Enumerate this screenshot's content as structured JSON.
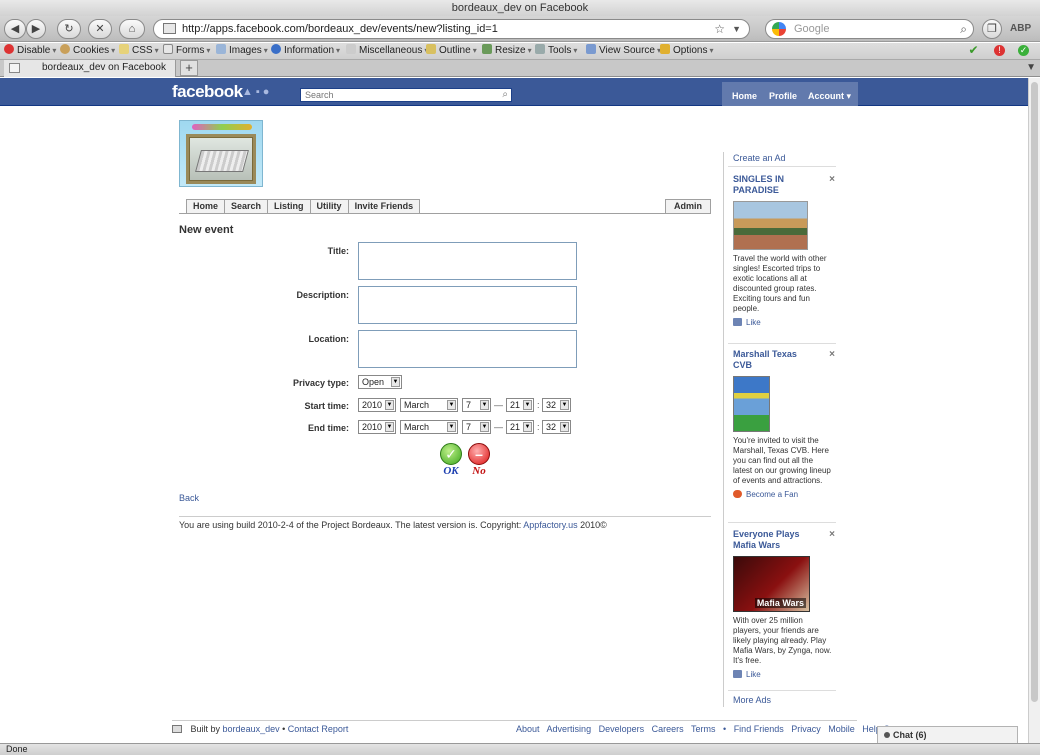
{
  "browser": {
    "window_title": "bordeaux_dev on Facebook",
    "url": "http://apps.facebook.com/bordeaux_dev/events/new?listing_id=1",
    "search_placeholder": "Google",
    "abp": "ABP",
    "tab_title": "bordeaux_dev on Facebook",
    "status": "Done",
    "dev_toolbar": [
      "Disable",
      "Cookies",
      "CSS",
      "Forms",
      "Images",
      "Information",
      "Miscellaneous",
      "Outline",
      "Resize",
      "Tools",
      "View Source",
      "Options"
    ]
  },
  "fb": {
    "logo": "facebook",
    "search_placeholder": "Search",
    "nav": {
      "home": "Home",
      "profile": "Profile",
      "account": "Account ▾"
    }
  },
  "app": {
    "tabs": [
      "Home",
      "Search",
      "Listing",
      "Utility",
      "Invite Friends"
    ],
    "admin_tab": "Admin",
    "heading": "New event",
    "form": {
      "title_label": "Title:",
      "description_label": "Description:",
      "location_label": "Location:",
      "privacy_label": "Privacy type:",
      "privacy_value": "Open",
      "start_label": "Start time:",
      "end_label": "End time:",
      "start": {
        "year": "2010",
        "month": "March",
        "day": "7",
        "hour": "21",
        "minute": "32"
      },
      "end": {
        "year": "2010",
        "month": "March",
        "day": "7",
        "hour": "21",
        "minute": "32"
      },
      "dash": "—",
      "colon": ":"
    },
    "ok_label": "OK",
    "no_label": "No",
    "back": "Back",
    "build_text": "You are using build 2010-2-4 of the Project Bordeaux. The latest version is. Copyright:",
    "build_link": "Appfactory.us",
    "build_year": "2010©"
  },
  "ads": {
    "create": "Create an Ad",
    "items": [
      {
        "title": "SINGLES IN PARADISE",
        "body": "Travel the world with other singles! Escorted trips to exotic locations all at discounted group rates. Exciting tours and fun people.",
        "action": "Like"
      },
      {
        "title": "Marshall Texas CVB",
        "body": "You're invited to visit the Marshall, Texas CVB. Here you can find out all the latest on our growing lineup of events and attractions.",
        "action": "Become a Fan"
      },
      {
        "title": "Everyone Plays Mafia Wars",
        "body": "With over 25 million players, your friends are likely playing already. Play Mafia Wars, by Zynga, now. It's free.",
        "action": "Like",
        "image_text": "Mafia Wars"
      }
    ],
    "more": "More Ads"
  },
  "footer": {
    "built_by": "Built by",
    "author": "bordeaux_dev",
    "bullet": "•",
    "contact": "Contact",
    "report": "Report",
    "links": [
      "About",
      "Advertising",
      "Developers",
      "Careers",
      "Terms",
      "•",
      "Find Friends",
      "Privacy",
      "Mobile",
      "Help Center"
    ],
    "chat": "Chat (6)"
  }
}
